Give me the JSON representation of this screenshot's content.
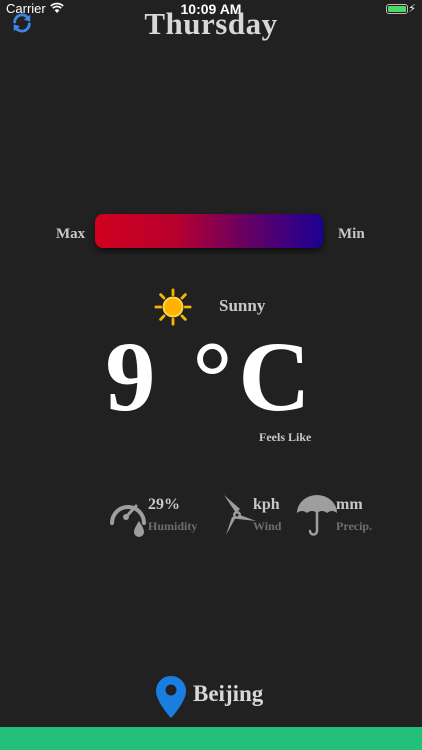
{
  "status_bar": {
    "carrier": "Carrier",
    "time": "10:09 AM"
  },
  "header": {
    "title": "Thursday",
    "refresh_icon": "refresh-icon"
  },
  "range": {
    "max_label": "Max",
    "min_label": "Min",
    "gradient_from": "#d1001e",
    "gradient_to": "#1c0094"
  },
  "current": {
    "icon": "sun-icon",
    "condition": "Sunny",
    "temperature": "9 °C",
    "feels_like_label": "Feels Like"
  },
  "stats": {
    "humidity": {
      "value": "29%",
      "label": "Humidity",
      "icon": "humidity-gauge-icon"
    },
    "wind": {
      "value": "kph",
      "label": "Wind",
      "icon": "wind-turbine-icon"
    },
    "precip": {
      "value": "mm",
      "label": "Precip.",
      "icon": "umbrella-icon"
    }
  },
  "location": {
    "city": "Beijing",
    "icon": "location-pin-icon",
    "pin_color": "#1a7ee0"
  },
  "colors": {
    "background": "#212121",
    "bottom_strip": "#23c07a"
  }
}
